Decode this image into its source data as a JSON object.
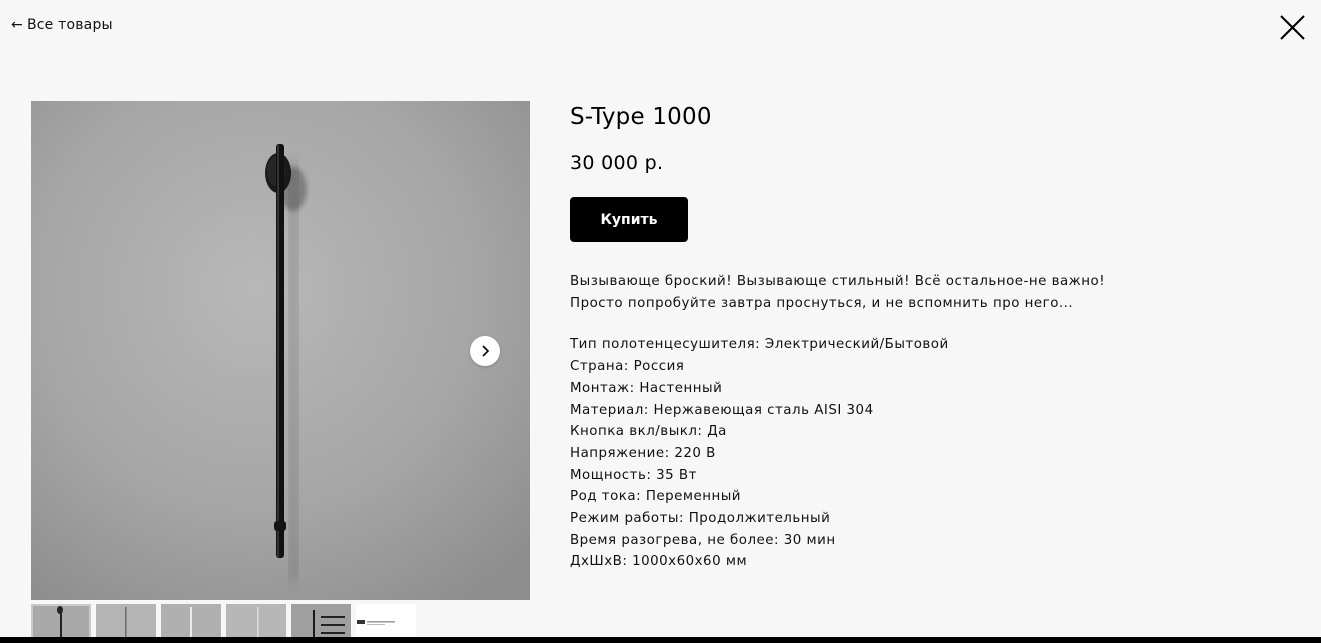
{
  "nav": {
    "back_arrow": "←",
    "back_label": "Все товары",
    "close_icon": "close-icon"
  },
  "product": {
    "title": "S-Type 1000",
    "price": "30 000 р.",
    "buy_label": "Купить",
    "description_lines": [
      "Вызывающе броский! Вызывающе стильный! Всё остальное-не важно!",
      "Просто попробуйте завтра проснуться, и не вспомнить про него..."
    ],
    "specs": [
      "Тип полотенцесушителя: Электрический/Бытовой",
      "Страна: Россия",
      "Монтаж: Настенный",
      "Материал: Нержавеющая сталь AISI 304",
      "Кнопка вкл/выкл: Да",
      "Напряжение: 220 В",
      "Мощность: 35 Вт",
      "Род тока: Переменный",
      "Режим работы: Продолжительный",
      "Время разогрева, не более: 30 мин",
      "ДхШхВ: 1000х60х60 мм"
    ]
  },
  "gallery": {
    "next_icon": "chevron-right-icon",
    "thumbnail_count": 6,
    "active_thumbnail": 1
  },
  "colors": {
    "background": "#f7f7f7",
    "button": "#000000",
    "button_text": "#ffffff",
    "photo_gray": "#a6a6a6"
  }
}
